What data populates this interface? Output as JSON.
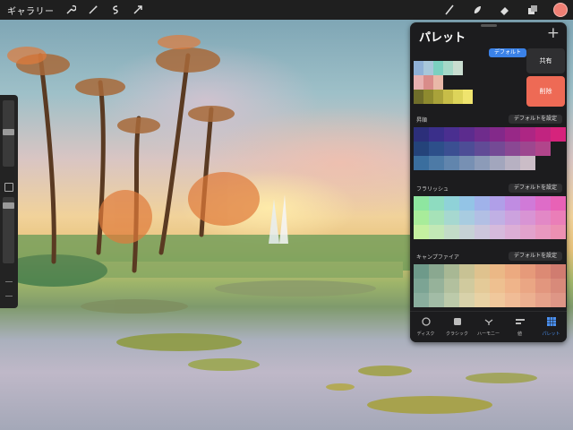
{
  "toolbar": {
    "gallery_label": "ギャラリー",
    "left_icons": [
      "wrench-icon",
      "magic-wand-icon",
      "selection-icon",
      "transform-arrow-icon"
    ],
    "right_icons": [
      "brush-icon",
      "smudge-icon",
      "eraser-icon",
      "layers-icon",
      "color-icon"
    ],
    "current_color": "#ef7f74"
  },
  "panel": {
    "title": "パレット",
    "add_label": "+",
    "share_label": "共有",
    "delete_label": "削除",
    "palettes": [
      {
        "name": "",
        "button": "デフォルト",
        "is_default": true,
        "rows": [
          [
            "#8fb0d6",
            "#a8c7da",
            "#7bd0c0",
            "#a5d8c8",
            "#c9ddd0",
            "",
            "",
            "",
            "",
            ""
          ],
          [
            "#e7b0b0",
            "#d98c8a",
            "#e9b8a8",
            "",
            "",
            "",
            "",
            "",
            "",
            ""
          ],
          [
            "#6f6d2a",
            "#8e8a2f",
            "#a9a23a",
            "#c7bd48",
            "#ddd45a",
            "#efe46e",
            "",
            "",
            "",
            ""
          ]
        ]
      },
      {
        "name": "昇順",
        "button": "デフォルトを設定",
        "is_default": false,
        "rows": [
          [
            "#2c2f7a",
            "#3a2f8a",
            "#4a2f90",
            "#5c2c8e",
            "#6f2c8c",
            "#83298a",
            "#982887",
            "#ad2684",
            "#c12480",
            "#d6237c"
          ],
          [
            "#24437a",
            "#2d4f8a",
            "#3b4f92",
            "#4d4d96",
            "#614b96",
            "#744a95",
            "#8a4893",
            "#9d478f",
            "#b1458b",
            ""
          ],
          [
            "#3a6e9e",
            "#4d7aa6",
            "#6185ad",
            "#7790b3",
            "#8c9bb8",
            "#a2a6bd",
            "#b7b1c2",
            "#cbbdc7",
            "",
            ""
          ]
        ]
      },
      {
        "name": "フラリッシュ",
        "button": "デフォルトを設定",
        "is_default": false,
        "rows": [
          [
            "#8ee6a0",
            "#8edcc0",
            "#8fd2d8",
            "#93c4e6",
            "#a0b2ea",
            "#b09fe8",
            "#c08ce2",
            "#d07ad8",
            "#de6cc8",
            "#e862b6"
          ],
          [
            "#a8ec9a",
            "#a6e2b8",
            "#a6d8d0",
            "#a8cce0",
            "#b2bfe4",
            "#c0b0e4",
            "#ccA2de",
            "#d894d4",
            "#e288c6",
            "#ea7eb8"
          ],
          [
            "#c4f0a0",
            "#c2e8b6",
            "#c2dcc8",
            "#c6d2d6",
            "#ccc6dc",
            "#d6badc",
            "#dcaed6",
            "#e2a2cc",
            "#e898c0",
            "#ec90b2"
          ]
        ]
      },
      {
        "name": "キャンプファイア",
        "button": "デフォルトを設定",
        "is_default": false,
        "rows": [
          [
            "#6e9a8a",
            "#8aa890",
            "#a8b894",
            "#c8c294",
            "#dfc28e",
            "#ebb886",
            "#ecaa80",
            "#e69a7a",
            "#dc8a74",
            "#d07c70"
          ],
          [
            "#7ca494",
            "#96b29a",
            "#b2c09e",
            "#d0ca9e",
            "#e4ca98",
            "#eec090",
            "#efb48a",
            "#eaa684",
            "#e2967e",
            "#d88a7a"
          ],
          [
            "#8aae9e",
            "#a2bca6",
            "#bccaaa",
            "#d8d2aa",
            "#e8d2a4",
            "#f0c89c",
            "#f0bc96",
            "#ecb090",
            "#e6a28a",
            "#de9686"
          ]
        ]
      }
    ],
    "tabs": [
      {
        "label": "ディスク",
        "icon": "disc-icon",
        "active": false
      },
      {
        "label": "クラシック",
        "icon": "classic-icon",
        "active": false
      },
      {
        "label": "ハーモニー",
        "icon": "harmony-icon",
        "active": false
      },
      {
        "label": "値",
        "icon": "value-icon",
        "active": false
      },
      {
        "label": "パレット",
        "icon": "palette-grid-icon",
        "active": true
      }
    ]
  }
}
